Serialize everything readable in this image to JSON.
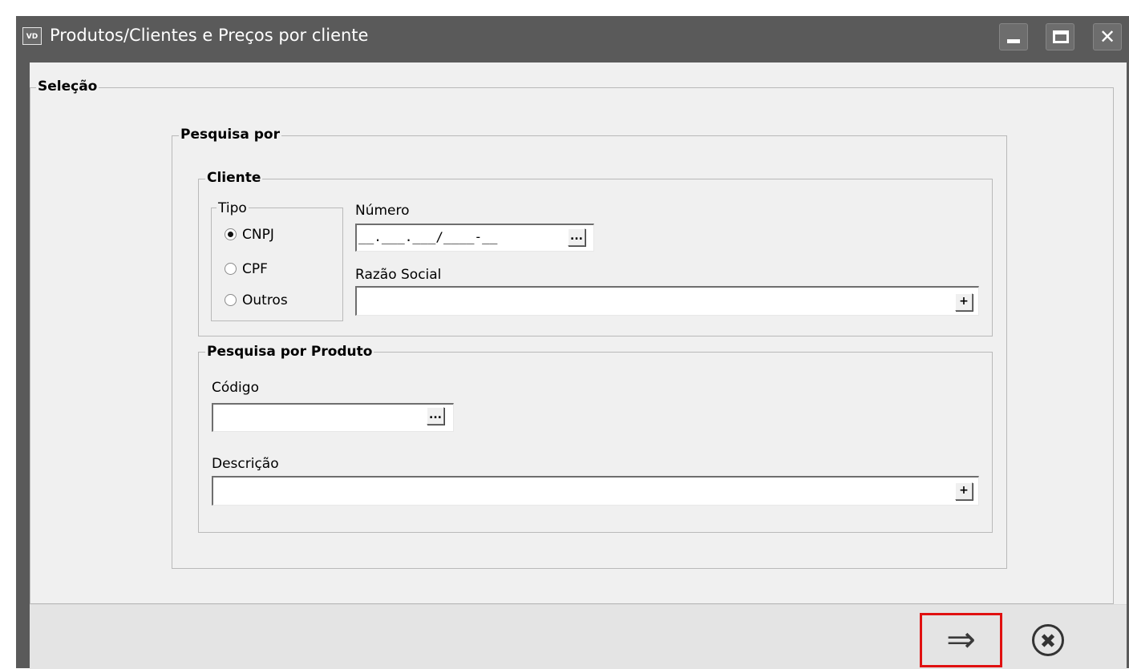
{
  "window": {
    "icon_text": "VD",
    "title": "Produtos/Clientes e Preços por cliente"
  },
  "selecao": {
    "legend": "Seleção",
    "pesquisa_por": {
      "legend": "Pesquisa por",
      "cliente": {
        "legend": "Cliente",
        "tipo": {
          "legend": "Tipo",
          "options": [
            {
              "label": "CNPJ",
              "checked": true
            },
            {
              "label": "CPF",
              "checked": false
            },
            {
              "label": "Outros",
              "checked": false
            }
          ]
        },
        "numero": {
          "label": "Número",
          "value": "__.___.___/____-__",
          "button": "..."
        },
        "razao_social": {
          "label": "Razão Social",
          "value": "",
          "button": "+"
        }
      },
      "produto": {
        "legend": "Pesquisa por Produto",
        "codigo": {
          "label": "Código",
          "value": "",
          "button": "..."
        },
        "descricao": {
          "label": "Descrição",
          "value": "",
          "button": "+"
        }
      }
    }
  },
  "footer": {
    "next_icon": "arrow-right-icon",
    "next_glyph": "⇒",
    "close_icon": "close-circle-icon"
  },
  "colors": {
    "titlebar": "#5a5a5a",
    "client_bg": "#f0f0f0",
    "highlight": "#e01010"
  }
}
